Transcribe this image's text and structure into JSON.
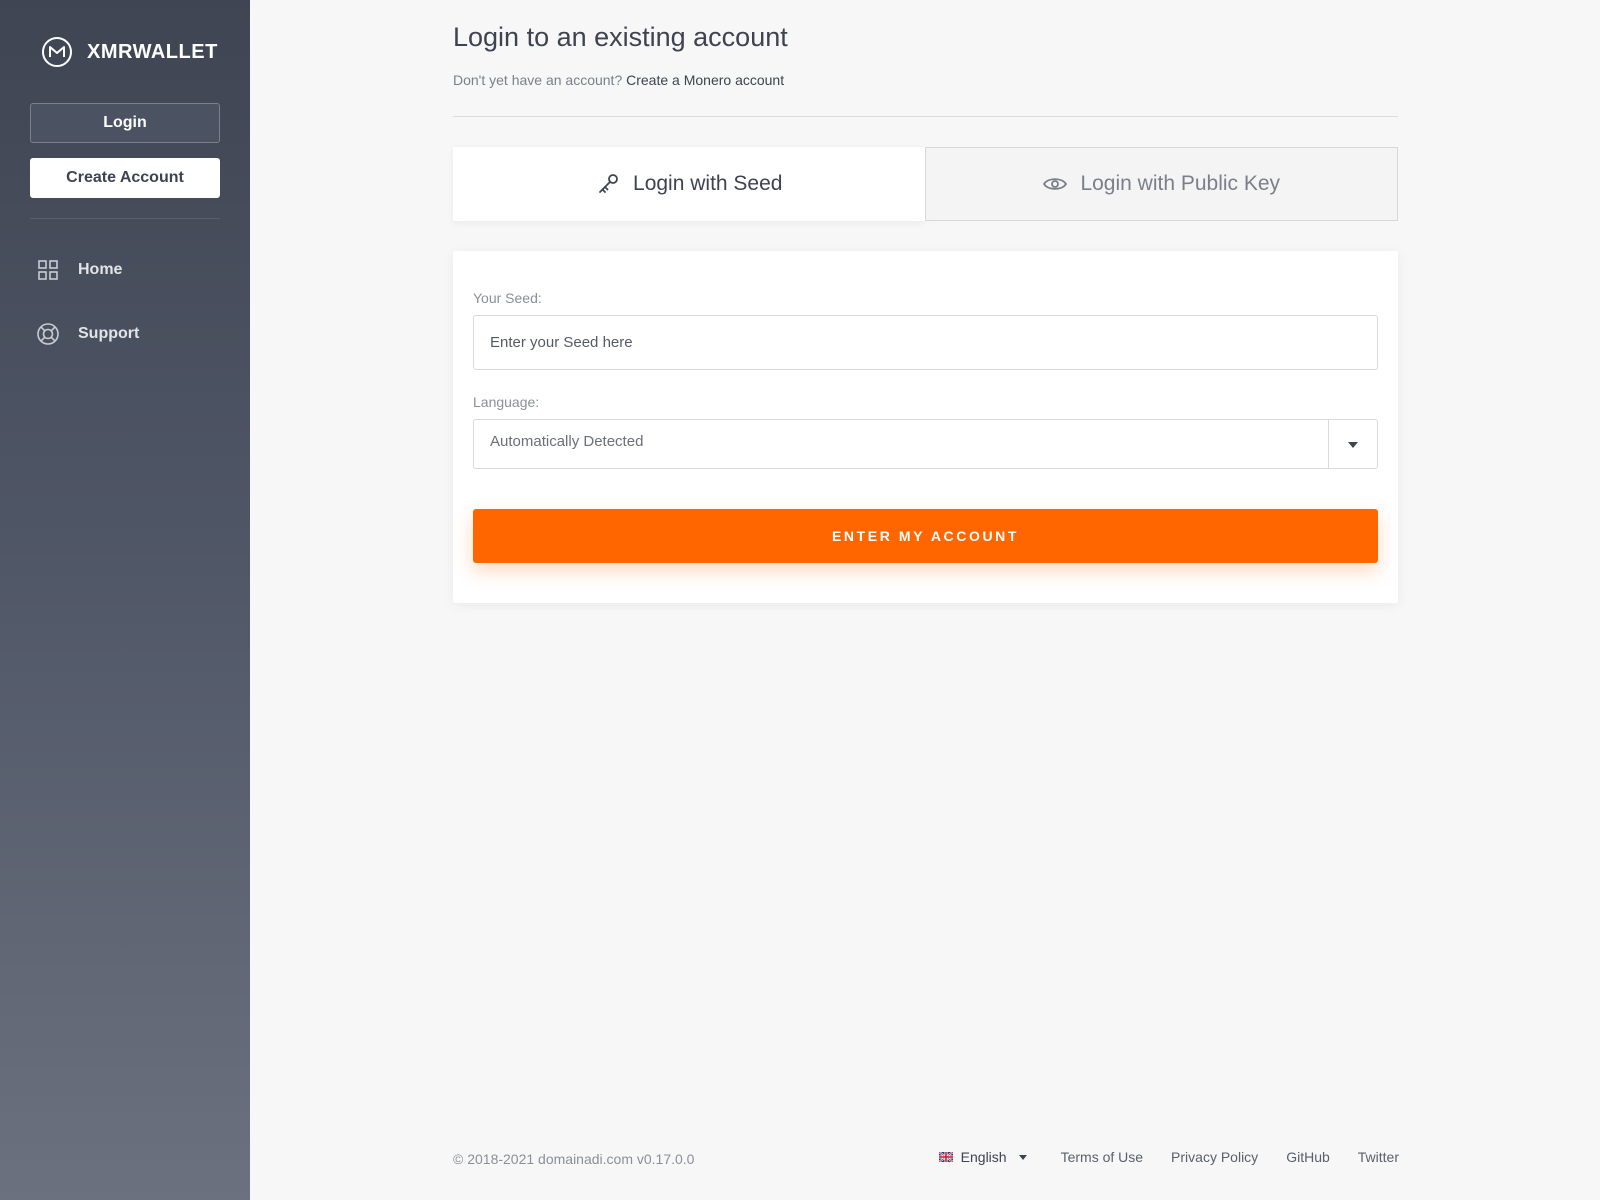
{
  "sidebar": {
    "brand": "XMRWALLET",
    "login_label": "Login",
    "create_label": "Create Account",
    "nav": [
      {
        "label": "Home",
        "icon": "grid-icon"
      },
      {
        "label": "Support",
        "icon": "lifebuoy-icon"
      }
    ]
  },
  "main": {
    "title": "Login to an existing account",
    "subtitle_prefix": "Don't yet have an account?",
    "subtitle_link": "Create a Monero account",
    "tabs": [
      {
        "label": "Login with Seed",
        "icon": "key-icon",
        "active": true
      },
      {
        "label": "Login with Public Key",
        "icon": "eye-icon",
        "active": false
      }
    ],
    "form": {
      "seed_label": "Your Seed:",
      "seed_placeholder": "Enter your Seed here",
      "seed_value": "",
      "language_label": "Language:",
      "language_value": "Automatically Detected",
      "submit_label": "ENTER MY ACCOUNT"
    }
  },
  "footer": {
    "copyright": "© 2018-2021 domainadi.com v0.17.0.0",
    "language": "English",
    "links": [
      "Terms of Use",
      "Privacy Policy",
      "GitHub",
      "Twitter"
    ]
  },
  "colors": {
    "accent": "#ff6600",
    "sidebar_top": "#3f4552",
    "sidebar_bottom": "#6b717e",
    "background": "#f7f7f7"
  }
}
